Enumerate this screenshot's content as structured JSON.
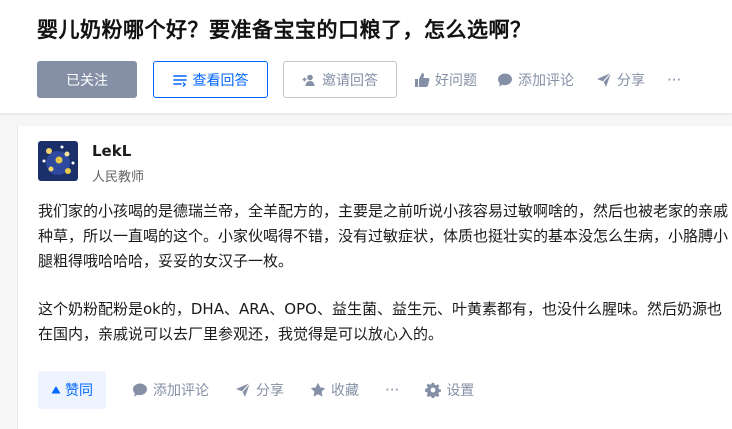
{
  "question": {
    "title": "婴儿奶粉哪个好？要准备宝宝的口粮了，怎么选啊？"
  },
  "question_actions": {
    "follow_label": "已关注",
    "view_answers_label": "查看回答",
    "invite_label": "邀请回答",
    "good_question_label": "好问题",
    "add_comment_label": "添加评论",
    "share_label": "分享",
    "more_label": "···"
  },
  "answer": {
    "author_name": "LekL",
    "author_title": "人民教师",
    "paragraphs": [
      "我们家的小孩喝的是德瑞兰帝，全羊配方的，主要是之前听说小孩容易过敏啊啥的，然后也被老家的亲戚种草，所以一直喝的这个。小家伙喝得不错，没有过敏症状，体质也挺壮实的基本没怎么生病，小胳膊小腿粗得哦哈哈哈，妥妥的女汉子一枚。",
      "这个奶粉配粉是ok的，DHA、ARA、OPO、益生菌、益生元、叶黄素都有，也没什么腥味。然后奶源也在国内，亲戚说可以去厂里参观还，我觉得是可以放心入的。"
    ]
  },
  "answer_actions": {
    "vote_label": "赞同",
    "comment_label": "添加评论",
    "share_label": "分享",
    "collect_label": "收藏",
    "more_label": "···",
    "settings_label": "设置"
  },
  "colors": {
    "brand_blue": "#0066ff",
    "muted_gray": "#8590a6",
    "vote_bg": "#eef4ff"
  },
  "icons": [
    "invite-person-icon",
    "list-icon",
    "thumb-up-icon",
    "comment-bubble-icon",
    "share-plane-icon",
    "up-triangle-icon",
    "star-icon",
    "gear-icon"
  ]
}
